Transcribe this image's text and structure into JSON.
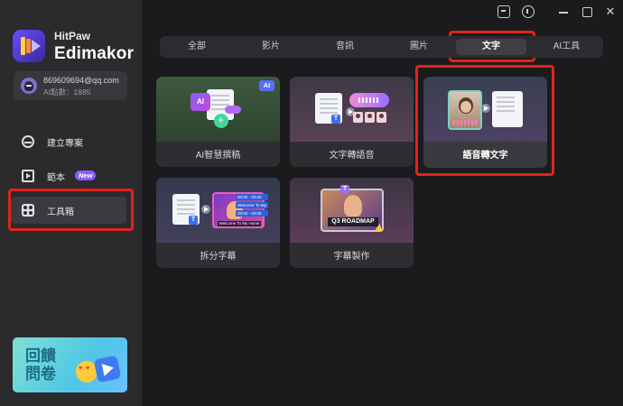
{
  "brand": {
    "top": "HitPaw",
    "main": "Edimakor"
  },
  "account": {
    "email": "869609694@qq.com",
    "points": "AI點數：1885"
  },
  "sidebar": {
    "items": [
      {
        "label": "建立專案",
        "icon": "new-project-icon"
      },
      {
        "label": "範本",
        "icon": "template-icon",
        "badge": "New"
      },
      {
        "label": "工具箱",
        "icon": "toolbox-icon"
      }
    ]
  },
  "banner": {
    "text": "回饋問卷"
  },
  "titlebar": {
    "close_glyph": "✕"
  },
  "tabs": [
    {
      "label": "全部"
    },
    {
      "label": "影片"
    },
    {
      "label": "音訊"
    },
    {
      "label": "圖片"
    },
    {
      "label": "文字"
    },
    {
      "label": "AI工具"
    }
  ],
  "cards": [
    {
      "title": "AI智慧撰稿",
      "ai_tag": "AI",
      "chip": "AI"
    },
    {
      "title": "文字轉語音",
      "badge": "T"
    },
    {
      "title": "語音轉文字"
    },
    {
      "title": "拆分字幕",
      "caption": "Welcome To My Home",
      "subs": [
        "00:00 - 00:02",
        "Welcome To My",
        "00:04 - 00:05",
        "Home"
      ],
      "badge": "T"
    },
    {
      "title": "字幕製作",
      "overlay": "Q3 ROADMAP",
      "badge": "T"
    }
  ],
  "colors": {
    "highlight": "#e2231a",
    "accent": "#8a5cff",
    "background": "#1b1b1d",
    "sidebar": "#2b2b2e"
  }
}
